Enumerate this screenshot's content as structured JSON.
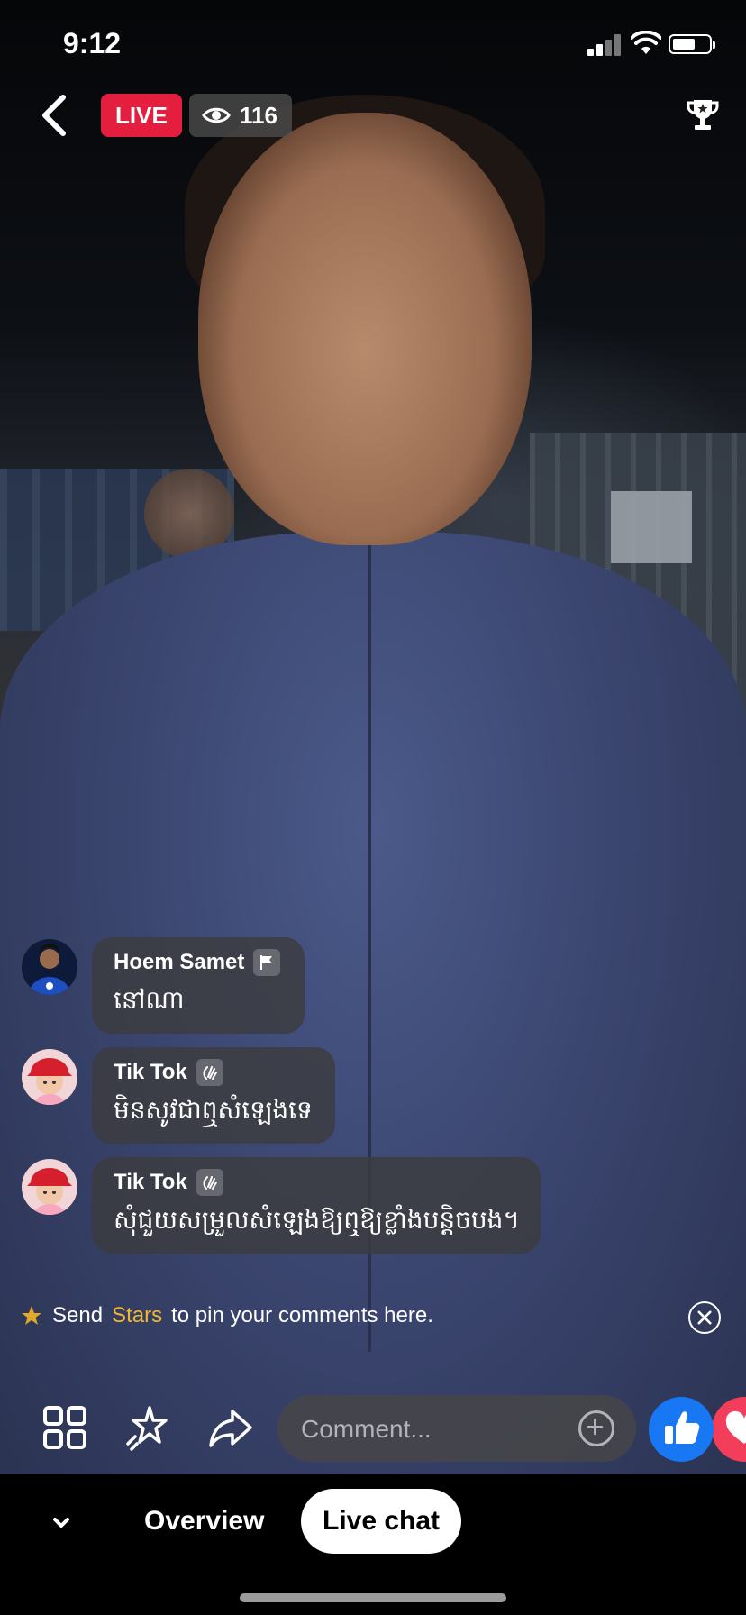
{
  "status": {
    "time": "9:12"
  },
  "header": {
    "live_label": "LIVE",
    "viewer_count": "116"
  },
  "comments": [
    {
      "name": "Hoem Samet",
      "text": "នៅណា",
      "role_icon": "flag-icon",
      "avatar": "avatar-man-blue-shirt"
    },
    {
      "name": "Tik Tok",
      "text": "មិនសូវជាឮសំឡេងទេ",
      "role_icon": "wave-icon",
      "avatar": "avatar-child-red-hat"
    },
    {
      "name": "Tik Tok",
      "text": "សុំជួយសម្រួលសំឡេងឱ្យឮឱ្យខ្លាំងបន្តិចបង។",
      "role_icon": "wave-icon",
      "avatar": "avatar-child-red-hat"
    }
  ],
  "stars_notice": {
    "prefix": "Send",
    "highlight": "Stars",
    "suffix": "to pin your comments here."
  },
  "comment_input": {
    "placeholder": "Comment..."
  },
  "tabs": {
    "overview": "Overview",
    "live_chat": "Live chat"
  },
  "colors": {
    "live_red": "#e41e3f",
    "stars_gold": "#f0b832",
    "like_blue": "#1877f2",
    "love_red": "#f33e5b"
  }
}
